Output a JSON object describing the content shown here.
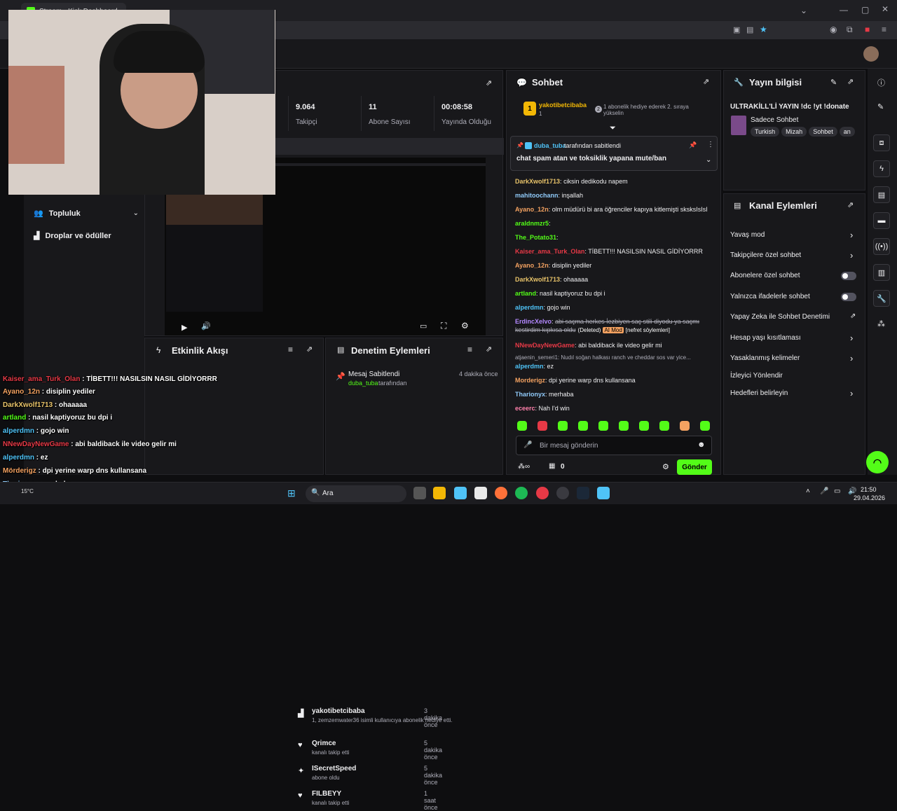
{
  "browser": {
    "tab_title": "Stream - Kick Dashboard",
    "window_controls": [
      "minimize",
      "maximize",
      "close"
    ]
  },
  "left_nav": {
    "community_label": "Topluluk",
    "drops_label": "Droplar ve ödüller"
  },
  "stats": {
    "followers_value": "9.064",
    "followers_label": "Takipçi",
    "subs_value": "11",
    "subs_label": "Abone Sayısı",
    "uptime_value": "00:08:58",
    "uptime_label": "Yayında Olduğu"
  },
  "activity": {
    "title": "Etkinlik Akışı",
    "items": [
      {
        "name": "yakotibetcibaba",
        "time": "3 dakika önce",
        "desc": "1, zemzemwater36 isimli kullanıcıya abonelik hediye etti."
      },
      {
        "name": "Qrimce",
        "time": "5 dakika önce",
        "desc": "kanalı takip etti"
      },
      {
        "name": "ISecretSpeed",
        "time": "5 dakika önce",
        "desc": "abone oldu"
      },
      {
        "name": "FILBEYY",
        "time": "1 saat önce",
        "desc": "kanalı takip etti"
      }
    ]
  },
  "moderation": {
    "title": "Denetim Eylemleri",
    "items": [
      {
        "action": "Mesaj Sabitlendi",
        "time": "4 dakika önce",
        "actor": "duba_tuba",
        "suffix": "tarafından"
      }
    ]
  },
  "chat": {
    "title": "Sohbet",
    "top_gifter": {
      "name": "yakotibetcibaba",
      "rank": "1",
      "count": "1",
      "note_count": "2",
      "note": "1 abonelik hediye ederek 2. sıraya yükselin"
    },
    "pinned": {
      "by_user": "duba_tuba",
      "by_suffix": "tarafından sabitlendi",
      "message": "chat spam atan ve toksiklik yapana mute/ban"
    },
    "messages": [
      {
        "user": "DarkXwolf1713",
        "color": "#e9c46a",
        "text": "ciksin dedikodu napem"
      },
      {
        "user": "mahitoochann",
        "color": "#90caf9",
        "text": "inşallah"
      },
      {
        "user": "Ayano_12n",
        "color": "#f4a261",
        "text": "olm müdürü bi ara öğrenciler kapıya kitlemişti sksksIsIsI"
      },
      {
        "user": "araldnmzr5",
        "color": "#53fc18",
        "text": ""
      },
      {
        "user": "The_Potato31",
        "color": "#53fc18",
        "text": ""
      },
      {
        "user": "Kaiser_ama_Turk_Olan",
        "color": "#e63946",
        "text": "TİBETT!!! NASILSIN NASIL GİDİYORRR"
      },
      {
        "user": "Ayano_12n",
        "color": "#f4a261",
        "text": "disiplin yediler"
      },
      {
        "user": "DarkXwolf1713",
        "color": "#e9c46a",
        "text": "ohaaaaa"
      },
      {
        "user": "artland",
        "color": "#53fc18",
        "text": "nasil kaptiyoruz bu dpi i"
      },
      {
        "user": "alperdmn",
        "color": "#4fc3f7",
        "text": "gojo win"
      },
      {
        "user": "ErdincXelvo",
        "color": "#b388ff",
        "text": "abi saçma herkes İezbiyen saç stili diyodu ya saçmı kestirdim kıpkısa oldu",
        "deleted": "(Deleted)",
        "mod_badge": "AI Mod",
        "reason": "[nefret söylemleri]"
      },
      {
        "user": "NNewDayNewGame",
        "color": "#e63946",
        "text": "abi baldiback ile video gelir mi"
      },
      {
        "user": "",
        "color": "#adadb8",
        "text": "atjaenin_semeri1: Nudıl soğan halkası ranch ve cheddar sos var yice..."
      },
      {
        "user": "alperdmn",
        "color": "#4fc3f7",
        "text": "ez"
      },
      {
        "user": "Morderigz",
        "color": "#f4a261",
        "text": "dpi yerine warp dns kullansana"
      },
      {
        "user": "Tharionyx",
        "color": "#90caf9",
        "text": "merhaba"
      },
      {
        "user": "eceerc",
        "color": "#ff80ab",
        "text": "Nah I'd win"
      }
    ],
    "input_placeholder": "Bir mesaj gönderin",
    "points": "0",
    "send_label": "Gönder"
  },
  "stream_info": {
    "title": "Yayın bilgisi",
    "stream_title": "ULTRAKİLL'Lİ YAYIN !dc !yt !donate",
    "chat_mode": "Sadece Sohbet",
    "tags": [
      "Turkish",
      "Mizah",
      "Sohbet",
      "an"
    ]
  },
  "channel_actions": {
    "title": "Kanal Eylemleri",
    "items": [
      {
        "label": "Yavaş mod",
        "control": "chevron"
      },
      {
        "label": "Takipçilere özel sohbet",
        "control": "chevron"
      },
      {
        "label": "Abonelere özel sohbet",
        "control": "toggle"
      },
      {
        "label": "Yalnızca ifadelerle sohbet",
        "control": "toggle"
      },
      {
        "label": "Yapay Zeka ile Sohbet Denetimi",
        "control": "external"
      },
      {
        "label": "Hesap yaşı kısıtlaması",
        "control": "chevron"
      },
      {
        "label": "Yasaklanmış kelimeler",
        "control": "chevron"
      },
      {
        "label": "İzleyici Yönlendir",
        "control": "none"
      },
      {
        "label": "Hedefleri belirleyin",
        "control": "chevron"
      }
    ]
  },
  "overlay_chat": [
    {
      "user": "Kaiser_ama_Turk_Olan",
      "color": "#e63946",
      "text": "TİBETT!!! NASILSIN NASIL GİDİYORRR"
    },
    {
      "user": "Ayano_12n",
      "color": "#f4a261",
      "text": "disiplin yediler"
    },
    {
      "user": "DarkXwolf1713",
      "color": "#e9c46a",
      "text": "ohaaaaa"
    },
    {
      "user": "artland",
      "color": "#53fc18",
      "text": "nasil kaptiyoruz bu dpi i"
    },
    {
      "user": "alperdmn",
      "color": "#4fc3f7",
      "text": "gojo win"
    },
    {
      "user": "NNewDayNewGame",
      "color": "#e63946",
      "text": "abi baldiback ile video gelir mi"
    },
    {
      "user": "alperdmn",
      "color": "#4fc3f7",
      "text": "ez"
    },
    {
      "user": "Mörderigz",
      "color": "#f4a261",
      "text": "dpi yerine warp dns kullansana"
    },
    {
      "user": "Tharionyx",
      "color": "#90caf9",
      "text": "merhaba"
    },
    {
      "user": "eceerc",
      "color": "#ff80ab",
      "text": "Nah I'd win"
    }
  ],
  "taskbar": {
    "search_placeholder": "Ara",
    "temperature": "15°C",
    "time": "21:50",
    "date": "29.04.2026"
  }
}
